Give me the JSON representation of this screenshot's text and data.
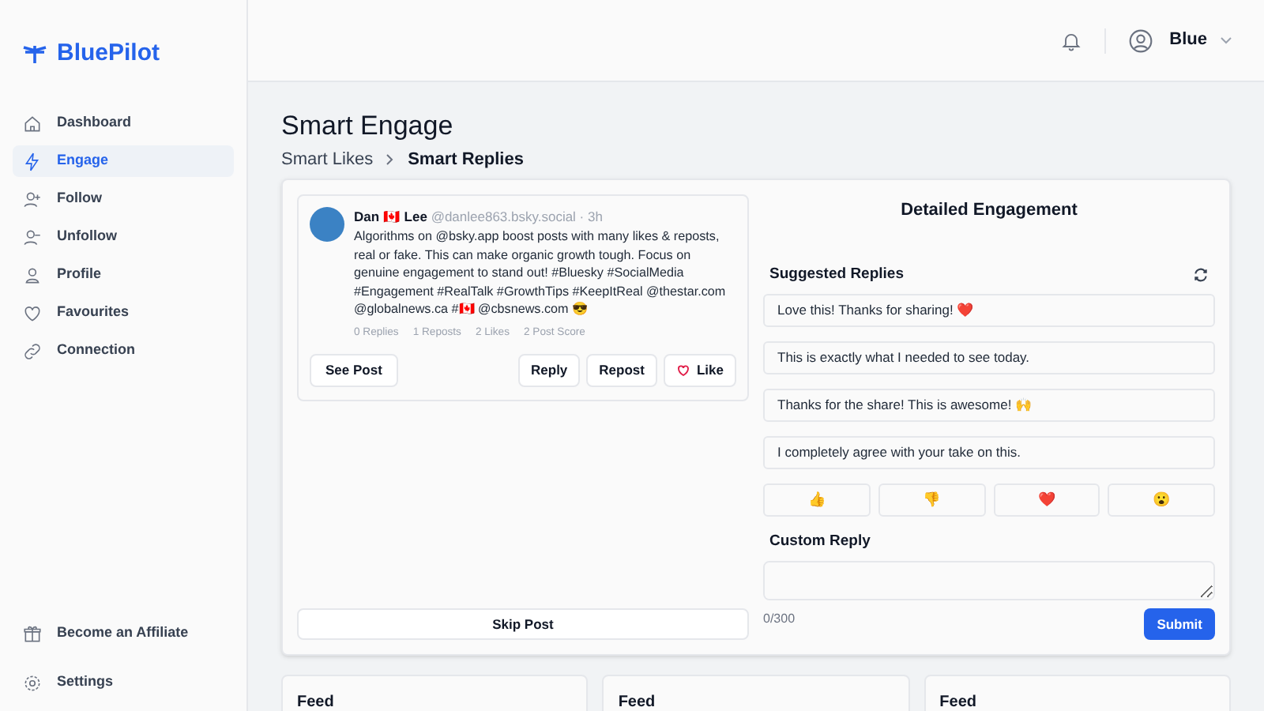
{
  "brand": "BluePilot",
  "sidebar": {
    "items": [
      {
        "label": "Dashboard",
        "selected": false
      },
      {
        "label": "Engage",
        "selected": true
      },
      {
        "label": "Follow",
        "selected": false
      },
      {
        "label": "Unfollow",
        "selected": false
      },
      {
        "label": "Profile",
        "selected": false
      },
      {
        "label": "Favourites",
        "selected": false
      },
      {
        "label": "Connection",
        "selected": false
      }
    ],
    "bottom_items": [
      {
        "label": "Become an Affiliate"
      },
      {
        "label": "Settings"
      }
    ]
  },
  "header": {
    "user": "Blue"
  },
  "page": {
    "title": "Smart Engage",
    "breadcrumb": [
      "Smart Likes",
      "Smart Replies"
    ]
  },
  "post": {
    "name": "Dan 🇨🇦 Lee",
    "handle": "@danlee863.bsky.social · 3h",
    "text": "Algorithms on @bsky.app boost posts with many likes & reposts, real or fake. This can make organic growth tough. Focus on genuine engagement to stand out! #Bluesky #SocialMedia #Engagement #RealTalk #GrowthTips #KeepItReal @thestar.com @globalnews.ca #🇨🇦 @cbsnews.com 😎",
    "stats": [
      "0 Replies",
      "1 Reposts",
      "2 Likes",
      "2 Post Score"
    ],
    "see_post": "See Post",
    "actions": [
      "Reply",
      "Repost",
      "Like"
    ],
    "skip": "Skip Post"
  },
  "engagement": {
    "title": "Detailed Engagement",
    "suggested_title": "Suggested Replies",
    "suggestions": [
      "Love this! Thanks for sharing! ❤️",
      "This is exactly what I needed to see today.",
      "Thanks for the share! This is awesome! 🙌",
      "I completely agree with your take on this."
    ],
    "reactions": [
      "👍",
      "👎",
      "❤️",
      "😮"
    ],
    "custom_title": "Custom Reply",
    "counter": "0/300",
    "submit": "Submit"
  },
  "feeds": [
    {
      "title": "Feed"
    },
    {
      "title": "Feed"
    },
    {
      "title": "Feed"
    }
  ]
}
